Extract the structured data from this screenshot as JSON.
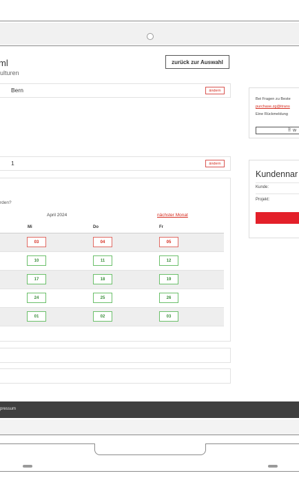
{
  "header": {
    "title": "ml",
    "subtitle": "ulturen",
    "back_button": "zurück zur Auswahl"
  },
  "selections": [
    {
      "value": "Bern",
      "change_label": "ändern"
    },
    {
      "value": "1",
      "change_label": "ändern"
    }
  ],
  "calendar": {
    "question": "rden?",
    "month_label": "April 2024",
    "next_month": "nächster Monat",
    "columns": [
      "Mi",
      "Do",
      "Fr"
    ],
    "weeks": [
      {
        "days": [
          "03",
          "04",
          "05"
        ],
        "closed": [
          true,
          true,
          true
        ]
      },
      {
        "days": [
          "10",
          "11",
          "12"
        ],
        "closed": [
          false,
          false,
          false
        ]
      },
      {
        "days": [
          "17",
          "18",
          "19"
        ],
        "closed": [
          false,
          false,
          false
        ]
      },
      {
        "days": [
          "24",
          "25",
          "26"
        ],
        "closed": [
          false,
          false,
          false
        ]
      },
      {
        "days": [
          "01",
          "02",
          "03"
        ],
        "closed": [
          false,
          false,
          false
        ]
      }
    ]
  },
  "sidebar": {
    "contact_line1": "Bei Fragen zu Beste",
    "contact_email": "purchase.zg@itrans",
    "contact_line3": "Eine Rückmeldung",
    "contact_button": "W",
    "customer_title": "Kundennar",
    "customer_label": "Kunde:",
    "project_label": "Projekt:"
  },
  "footer": {
    "link": "pressum"
  },
  "colors": {
    "accent_red": "#d52b1e",
    "available_green": "#3a8d3a",
    "footer_bg": "#3f3f3f"
  }
}
